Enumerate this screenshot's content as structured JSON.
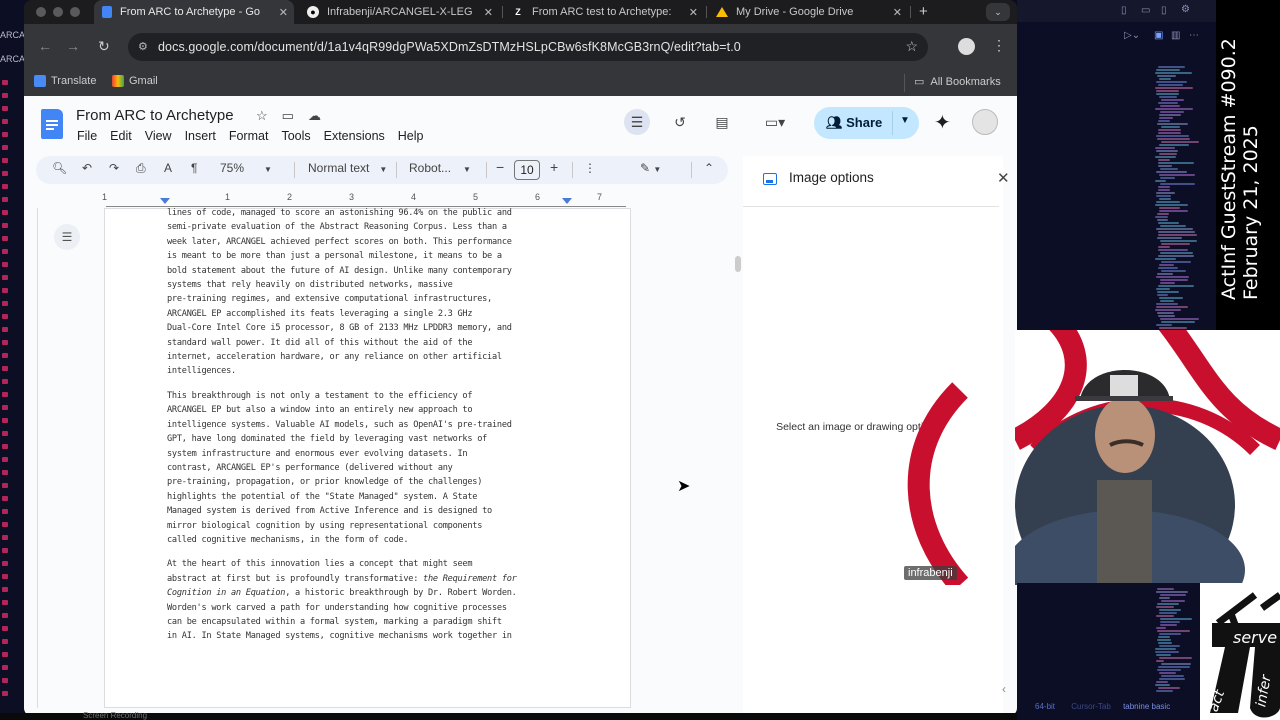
{
  "background_editor": {
    "left_labels": [
      "ARCAN",
      "ARCA"
    ],
    "status_bar": [
      "64-bit",
      "Cursor-Tab",
      "tabnine basic"
    ]
  },
  "browser": {
    "tabs": [
      {
        "label": "From ARC to Archetype - Go",
        "icon": "google-docs-icon",
        "active": true
      },
      {
        "label": "Infrabenji/ARCANGEL-X-LEG",
        "icon": "github-icon",
        "active": false
      },
      {
        "label": "From ARC test to Archetype:",
        "icon": "zenodo-icon",
        "active": false
      },
      {
        "label": "My Drive - Google Drive",
        "icon": "google-drive-icon",
        "active": false
      }
    ],
    "new_tab": "+",
    "url": "docs.google.com/document/d/1a1v4qR99dgPWa5XDmZsDTMzHSLpCBw6sfK8McGB3rnQ/edit?tab=t.0",
    "bookmarks": [
      {
        "label": "Translate",
        "icon": "translate-icon"
      },
      {
        "label": "Gmail",
        "icon": "gmail-icon"
      }
    ],
    "all_bookmarks": "All Bookmarks"
  },
  "docs": {
    "title": "From ARC to Archetype",
    "menu": [
      "File",
      "Edit",
      "View",
      "Insert",
      "Format",
      "Tools",
      "Extensions",
      "Help"
    ],
    "share_label": "Share",
    "toolbar": {
      "zoom": "75%",
      "style": "Normal text",
      "font": "Robot...",
      "font_size": "10"
    },
    "ruler_numbers": [
      "1",
      "1",
      "2",
      "3",
      "4",
      "5",
      "6",
      "7"
    ],
    "paragraphs": [
      {
        "text": "lines of code, managed to score an astonishing 96.4% on the public and\nsemi-private evaluation of the Abstract Reasoning Corpus. Less than a\nweek later, ARCANGEL achieved perfect scores on both. This performance\nis meant to be more than just a personal milestone, it means to be a\nbold statement about the future of AI design. Unlike many contemporary\nsystems that rely heavily on distributed networks, massive\npre-training regimes, and extensive computational infrastructures,\nARCANGEL EP accomplished its feats leveraging a single 2.3 GHz\nDual-Core Intel Core i5 processor, 8 GB of 2133 MHz LPDDR3 memory, and\nstandard wall power. It did all of this without the aid of the\ninternet, acceleration hardware, or any reliance on other artificial\nintelligences."
      },
      {
        "text": "This breakthrough is not only a testament to the efficiency of\nARCANGEL EP but also a window into an entirely new approach to\nintelligence systems. Valuable AI models, such as OpenAI's pre-trained\nGPT, have long dominated the field by leveraging vast networks of\nsystem infrastructure and enormous ever evolving datasets. In\ncontrast, ARCANGEL EP's performance (delivered without any\npre-training, propagation, or prior knowledge of the challenges)\nhighlights the potential of the \"State Managed\" system. A State\nManaged system is derived from Active Inference and is designed to\nmirror biological cognition by using representational components\ncalled cognitive mechanisms, in the form of code."
      },
      {
        "text_before": "At the heart of this innovation lies a concept that might seem\nabstract at first but is profoundly transformative: ",
        "italic": "the Requirement for\nCognition in an Equation",
        "text_after": ", a historic breakthrough by Dr. Robert Worden.\nWorden's work carved a path for understanding how cognitive processes\ncan be encapsulated within a formal system, marking a paradigm shift\nin AI. In State Managed systems, cognitive mechanisms work together in"
      }
    ],
    "side_panel": {
      "title": "Image options",
      "message": "Select an image or drawing options."
    }
  },
  "overlay": {
    "stream_title": "ActInf GuestStream #090.2",
    "stream_date": "February 21, 2025",
    "participant_name": "infrabenji",
    "logo_words": [
      "serve",
      "act",
      "infer"
    ],
    "bottom_caption": "Screen Recording"
  }
}
